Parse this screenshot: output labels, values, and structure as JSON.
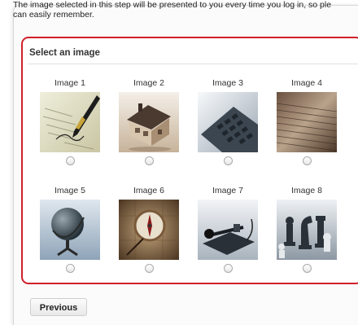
{
  "intro": {
    "line1": "The image selected in this step will be presented to you every time you log in, so ple",
    "line2": "can easily remember."
  },
  "section": {
    "title": "Select an image"
  },
  "images": [
    {
      "label": "Image 1",
      "icon": "pen-signing-document-icon",
      "selected": false
    },
    {
      "label": "Image 2",
      "icon": "house-model-icon",
      "selected": false
    },
    {
      "label": "Image 3",
      "icon": "calculator-keypad-icon",
      "selected": false
    },
    {
      "label": "Image 4",
      "icon": "old-manuscript-icon",
      "selected": false
    },
    {
      "label": "Image 5",
      "icon": "globe-icon",
      "selected": false
    },
    {
      "label": "Image 6",
      "icon": "compass-map-icon",
      "selected": false
    },
    {
      "label": "Image 7",
      "icon": "telegraph-key-icon",
      "selected": false
    },
    {
      "label": "Image 8",
      "icon": "chess-pieces-icon",
      "selected": false
    }
  ],
  "buttons": {
    "previous": "Previous"
  },
  "colors": {
    "highlight_border": "#d0202a"
  }
}
